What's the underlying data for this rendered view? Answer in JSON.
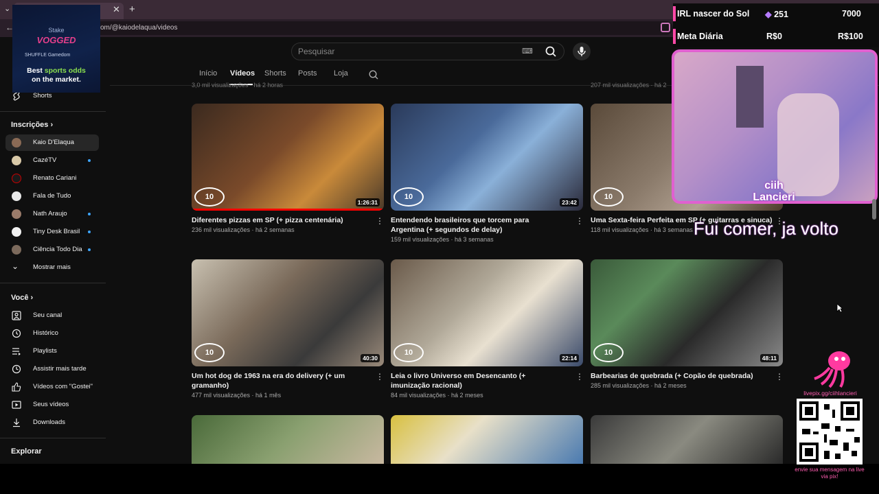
{
  "browser": {
    "url": "om/@kaiodelaqua/videos"
  },
  "search": {
    "placeholder": "Pesquisar"
  },
  "channel_tabs": [
    "Início",
    "Vídeos",
    "Shorts",
    "Posts",
    "Loja"
  ],
  "cutoff_meta": {
    "left": "3,0 mil visualizações · há 2 horas",
    "right": "207 mil visualizações · há 2"
  },
  "sidebar": {
    "shorts_label": "Shorts",
    "subscriptions_title": "Inscrições",
    "subscriptions": [
      {
        "label": "Kaio D'Elaqua",
        "active": true,
        "dot": false
      },
      {
        "label": "CazéTV",
        "active": false,
        "dot": true
      },
      {
        "label": "Renato Cariani",
        "active": false,
        "dot": false
      },
      {
        "label": "Fala de Tudo",
        "active": false,
        "dot": false
      },
      {
        "label": "Nath Araujo",
        "active": false,
        "dot": true
      },
      {
        "label": "Tiny Desk Brasil",
        "active": false,
        "dot": true
      },
      {
        "label": "Ciência Todo Dia",
        "active": false,
        "dot": true
      }
    ],
    "show_more": "Mostrar mais",
    "you_title": "Você",
    "you_items": [
      {
        "label": "Seu canal",
        "icon": "user-square-icon"
      },
      {
        "label": "Histórico",
        "icon": "history-icon"
      },
      {
        "label": "Playlists",
        "icon": "playlist-icon"
      },
      {
        "label": "Assistir mais tarde",
        "icon": "clock-icon"
      },
      {
        "label": "Vídeos com \"Gostei\"",
        "icon": "thumbs-up-icon"
      },
      {
        "label": "Seus vídeos",
        "icon": "video-icon"
      },
      {
        "label": "Downloads",
        "icon": "download-icon"
      }
    ],
    "explore_title": "Explorar"
  },
  "ad": {
    "brand": "Stake",
    "logo": "VOGGED",
    "sub": "SHUFFLE   Gamedom",
    "tagline_pre": "Best ",
    "tagline_hl": "sports odds",
    "tagline_post": "on the market."
  },
  "videos": [
    {
      "title": "Diferentes pizzas em SP (+ pizza centenária)",
      "views": "236 mil visualizações",
      "age": "há 2 semanas",
      "duration": "1:26:31",
      "progress": 1.0
    },
    {
      "title": "Entendendo brasileiros que torcem para Argentina (+ segundos de delay)",
      "views": "159 mil visualizações",
      "age": "há 3 semanas",
      "duration": "23:42",
      "progress": 0
    },
    {
      "title": "Uma Sexta-feira Perfeita em SP (+ guitarras e sinuca)",
      "views": "118 mil visualizações",
      "age": "há 3 semanas",
      "duration": "",
      "progress": 0
    },
    {
      "title": "Um hot dog de 1963 na era do delivery (+ um gramanho)",
      "views": "477 mil visualizações",
      "age": "há 1 mês",
      "duration": "40:30",
      "progress": 0
    },
    {
      "title": "Leia o livro Universo em Desencanto (+ imunização racional)",
      "views": "84 mil visualizações",
      "age": "há 2 meses",
      "duration": "22:14",
      "progress": 0
    },
    {
      "title": "Barbearias de quebrada (+ Copão de quebrada)",
      "views": "285 mil visualizações",
      "age": "há 2 meses",
      "duration": "48:11",
      "progress": 0
    }
  ],
  "thumb_logo": "10",
  "overlay": {
    "goal_label": "IRL nascer do Sol",
    "goal_count": "251",
    "goal_target": "7000",
    "daily_label": "Meta Diária",
    "daily_current": "R$0",
    "daily_target": "R$100",
    "streamer_line1": "ciih",
    "streamer_line2": "Lancieri",
    "status": "Fui comer, ja volto",
    "livepix_url": "livepix.gg/ciihlancieri",
    "qr_caption": "envie sua mensagem na live via pix!"
  },
  "colors": {
    "youtube_bg": "#0f0f0f",
    "accent_red": "#ff0000",
    "overlay_pink": "#ff4aa8",
    "notif_blue": "#3ea6ff"
  }
}
